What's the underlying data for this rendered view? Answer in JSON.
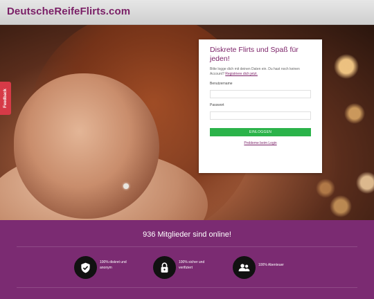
{
  "header": {
    "logo_text": "DeutscheReifeFlirts.com"
  },
  "feedback": {
    "label": "Feedback"
  },
  "login": {
    "title": "Diskrete Flirts und Spaß für jeden!",
    "subtitle": "Bitte logge dich mit deinen Daten ein. Du hast noch keinen Account?",
    "register_link": "Registriere dich jetzt.",
    "username_label": "Benutzername",
    "username_value": "",
    "password_label": "Passwort",
    "password_value": "",
    "login_button": "EINLOGGEN",
    "problem_link": "Probleme beim Login"
  },
  "stats": {
    "online_text": "936 Mitglieder sind online!",
    "features": [
      {
        "icon": "shield-check-icon",
        "label": "100% diskret und anonym"
      },
      {
        "icon": "lock-icon",
        "label": "100% sicher und verifiziert"
      },
      {
        "icon": "group-icon",
        "label": "100% Abenteuer"
      }
    ]
  },
  "colors": {
    "brand": "#7a1f66",
    "stats_bg": "#7b2b72",
    "login_button": "#2bb34a",
    "feedback": "#d63a47"
  }
}
